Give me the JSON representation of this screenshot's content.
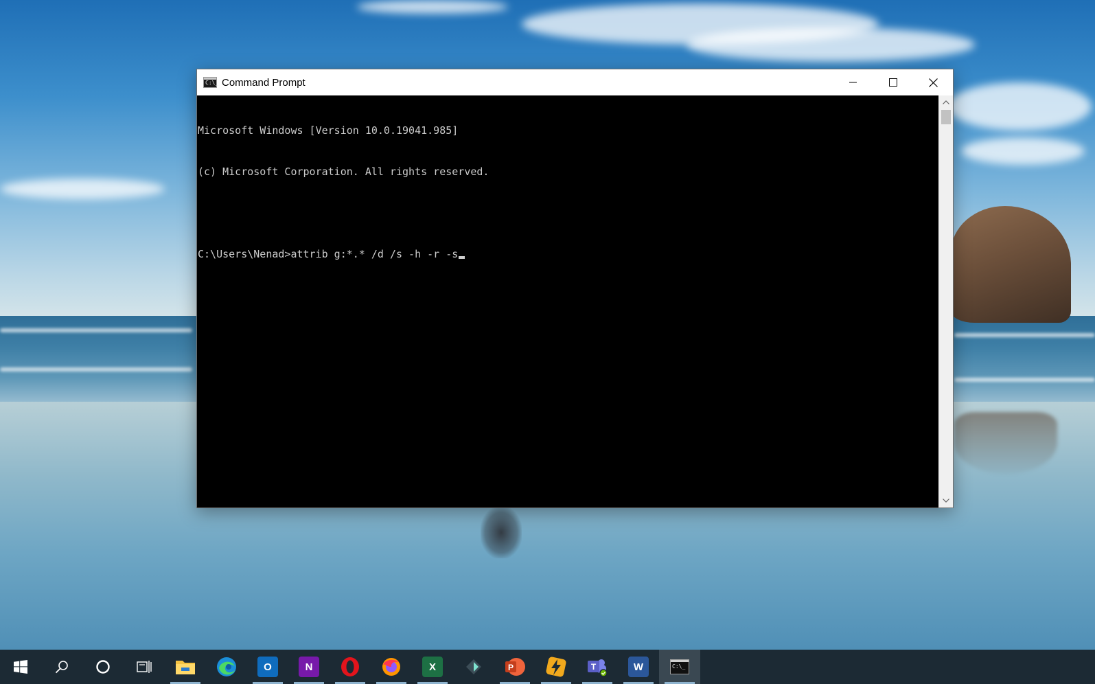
{
  "window": {
    "title": "Command Prompt",
    "icon": "cmd-icon",
    "icon_text": "C:\\_",
    "controls": [
      "minimize-icon",
      "maximize-icon",
      "close-icon"
    ]
  },
  "console": {
    "lines": [
      "Microsoft Windows [Version 10.0.19041.985]",
      "(c) Microsoft Corporation. All rights reserved.",
      "",
      "C:\\Users\\Nenad>attrib g:*.* /d /s -h -r -s"
    ],
    "text_color": "#cccccc",
    "background": "#000000"
  },
  "taskbar": {
    "items": [
      {
        "name": "start-button",
        "icon": "windows-logo-icon",
        "label": "",
        "underline": false
      },
      {
        "name": "search-button",
        "icon": "search-icon",
        "label": "",
        "underline": false
      },
      {
        "name": "cortana-button",
        "icon": "cortana-circle-icon",
        "label": "",
        "underline": false
      },
      {
        "name": "task-view-button",
        "icon": "task-view-icon",
        "label": "",
        "underline": false
      },
      {
        "name": "file-explorer-app",
        "icon": "folder-icon",
        "label": "",
        "underline": true
      },
      {
        "name": "edge-app",
        "icon": "edge-icon",
        "label": "",
        "underline": false
      },
      {
        "name": "outlook-app",
        "icon": "outlook-icon",
        "label": "O",
        "underline": true
      },
      {
        "name": "onenote-app",
        "icon": "onenote-icon",
        "label": "N",
        "underline": true
      },
      {
        "name": "opera-app",
        "icon": "opera-icon",
        "label": "",
        "underline": true
      },
      {
        "name": "firefox-app",
        "icon": "firefox-icon",
        "label": "",
        "underline": true
      },
      {
        "name": "excel-app",
        "icon": "excel-icon",
        "label": "X",
        "underline": true
      },
      {
        "name": "filmora-app",
        "icon": "filmora-icon",
        "label": "",
        "underline": false
      },
      {
        "name": "powerpoint-app",
        "icon": "powerpoint-icon",
        "label": "P",
        "underline": true
      },
      {
        "name": "winamp-app",
        "icon": "lightning-icon",
        "label": "",
        "underline": true
      },
      {
        "name": "teams-app",
        "icon": "teams-icon",
        "label": "T",
        "underline": true
      },
      {
        "name": "word-app",
        "icon": "word-icon",
        "label": "W",
        "underline": true
      },
      {
        "name": "command-prompt-app",
        "icon": "cmd-icon",
        "label": "C:\\_",
        "underline": true,
        "active": true
      }
    ]
  },
  "colors": {
    "taskbar": "#1c2a34",
    "taskbar_active": "#3a4852",
    "underline": "#8fb4cf",
    "excel": "#1d7044",
    "word": "#2b579a",
    "powerpoint": "#d24726",
    "onenote": "#7719aa",
    "outlook": "#0f6cbd",
    "teams": "#5b5fc7",
    "opera": "#e3141c",
    "folder": "#f5c342"
  }
}
